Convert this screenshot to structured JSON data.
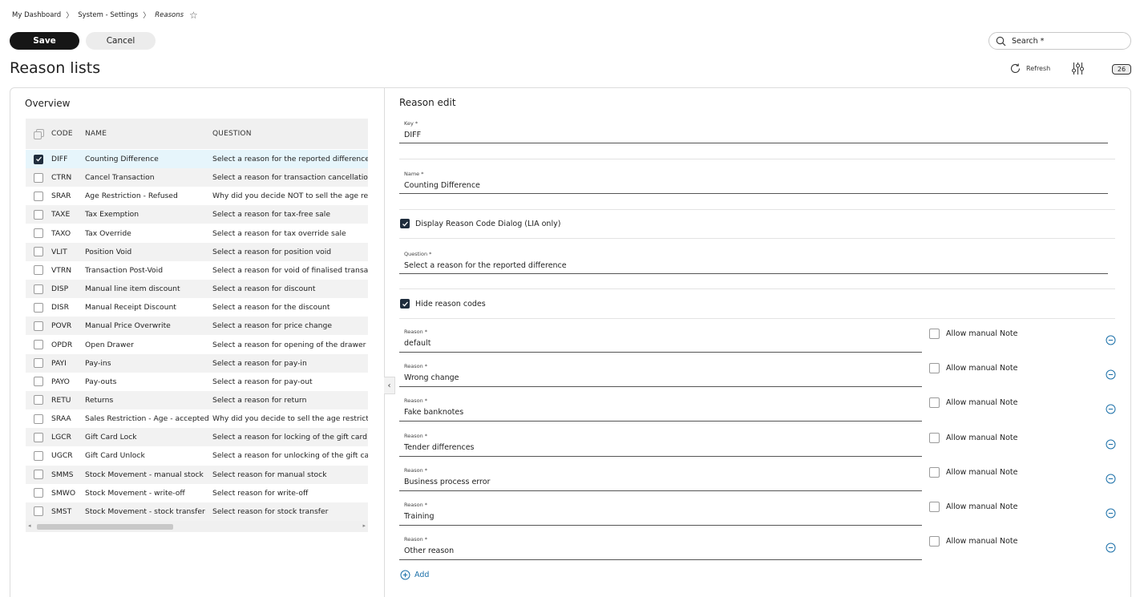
{
  "breadcrumb": {
    "items": [
      "My Dashboard",
      "System - Settings",
      "Reasons"
    ],
    "separator": "〉",
    "star": "☆"
  },
  "toolbar": {
    "save_label": "Save",
    "cancel_label": "Cancel",
    "search_label": "Search *"
  },
  "page": {
    "title": "Reason lists",
    "refresh_label": "Refresh",
    "count": "26"
  },
  "overview": {
    "title": "Overview",
    "columns": [
      "CODE",
      "NAME",
      "QUESTION"
    ],
    "rows": [
      {
        "code": "DIFF",
        "name": "Counting Difference",
        "question": "Select a reason for the reported difference",
        "checked": true
      },
      {
        "code": "CTRN",
        "name": "Cancel Transaction",
        "question": "Select a reason for transaction cancellation",
        "checked": false
      },
      {
        "code": "SRAR",
        "name": "Age Restriction - Refused",
        "question": "Why did you decide NOT to sell the age restricted",
        "checked": false
      },
      {
        "code": "TAXE",
        "name": "Tax Exemption",
        "question": "Select a reason for tax-free sale",
        "checked": false
      },
      {
        "code": "TAXO",
        "name": "Tax Override",
        "question": "Select a reason for tax override sale",
        "checked": false
      },
      {
        "code": "VLIT",
        "name": "Position Void",
        "question": "Select a reason for position void",
        "checked": false
      },
      {
        "code": "VTRN",
        "name": "Transaction Post-Void",
        "question": "Select a reason for void of finalised transaction",
        "checked": false
      },
      {
        "code": "DISP",
        "name": "Manual line item discount",
        "question": "Select a reason for discount",
        "checked": false
      },
      {
        "code": "DISR",
        "name": "Manual Receipt Discount",
        "question": "Select a reason for the discount",
        "checked": false
      },
      {
        "code": "POVR",
        "name": "Manual Price Overwrite",
        "question": "Select a reason for price change",
        "checked": false
      },
      {
        "code": "OPDR",
        "name": "Open Drawer",
        "question": "Select a reason for opening of the drawer",
        "checked": false
      },
      {
        "code": "PAYI",
        "name": "Pay-ins",
        "question": "Select a reason for pay-in",
        "checked": false
      },
      {
        "code": "PAYO",
        "name": "Pay-outs",
        "question": "Select a reason for pay-out",
        "checked": false
      },
      {
        "code": "RETU",
        "name": "Returns",
        "question": "Select a reason for return",
        "checked": false
      },
      {
        "code": "SRAA",
        "name": "Sales Restriction - Age - accepted",
        "question": "Why did you decide to sell the age restricted",
        "checked": false
      },
      {
        "code": "LGCR",
        "name": "Gift Card Lock",
        "question": "Select a reason for locking of the gift card:",
        "checked": false
      },
      {
        "code": "UGCR",
        "name": "Gift Card Unlock",
        "question": "Select a reason for unlocking of the gift card",
        "checked": false
      },
      {
        "code": "SMMS",
        "name": "Stock Movement - manual stock",
        "question": "Select reason for manual stock",
        "checked": false
      },
      {
        "code": "SMWO",
        "name": "Stock Movement - write-off",
        "question": "Select reason for write-off",
        "checked": false
      },
      {
        "code": "SMST",
        "name": "Stock Movement - stock transfer",
        "question": "Select reason for stock transfer",
        "checked": false
      }
    ]
  },
  "edit": {
    "title": "Reason edit",
    "key_label": "Key *",
    "key_value": "DIFF",
    "name_label": "Name *",
    "name_value": "Counting Difference",
    "display_dialog_label": "Display Reason Code Dialog (LIA only)",
    "display_dialog_checked": true,
    "question_label": "Question *",
    "question_value": "Select a reason for the reported difference",
    "hide_codes_label": "Hide reason codes",
    "hide_codes_checked": true,
    "reason_label": "Reason *",
    "allow_note_label": "Allow manual Note",
    "reasons": [
      "default",
      "Wrong change",
      "Fake banknotes",
      "Tender differences",
      "Business process error",
      "Training",
      "Other reason"
    ],
    "add_label": "Add"
  },
  "colors": {
    "primary": "#161616",
    "checkbox_checked": "#1f2d3d",
    "selected_row": "#e6f5fb",
    "link": "#1a6fa8"
  }
}
